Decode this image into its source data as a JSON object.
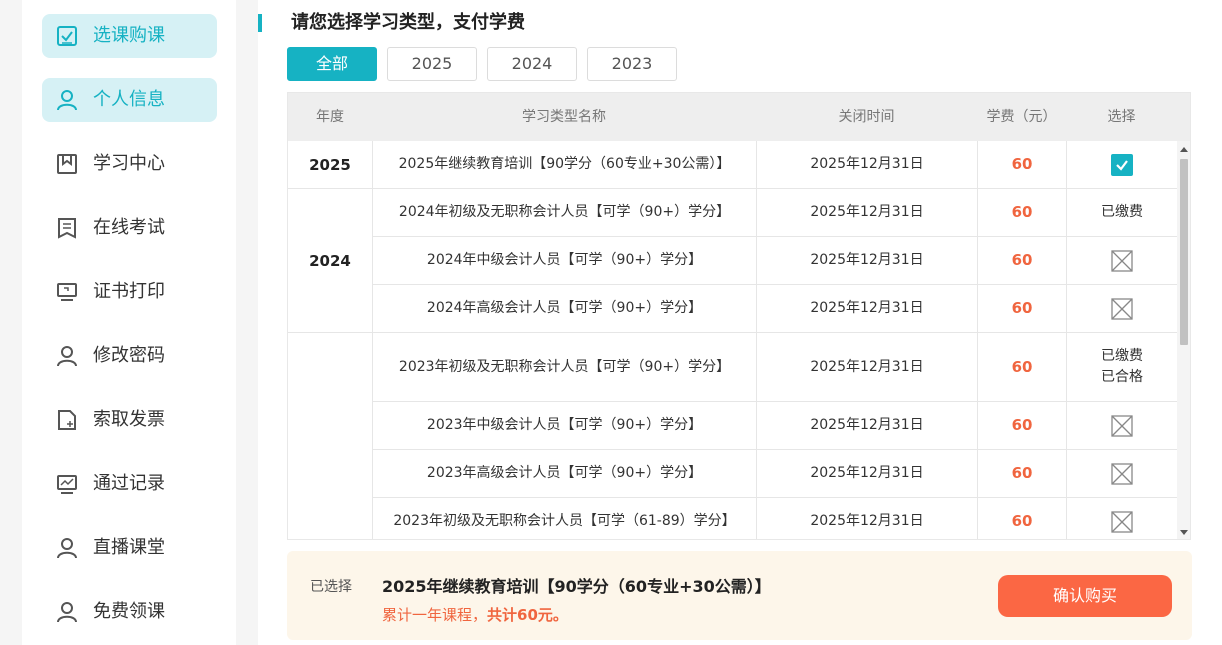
{
  "sidebar": {
    "items": [
      {
        "label": "选课购课",
        "icon": "checkbox-icon",
        "active": true
      },
      {
        "label": "个人信息",
        "icon": "user-icon",
        "active": true
      },
      {
        "label": "学习中心",
        "icon": "bookmark-icon",
        "active": false
      },
      {
        "label": "在线考试",
        "icon": "document-icon",
        "active": false
      },
      {
        "label": "证书打印",
        "icon": "monitor-icon",
        "active": false
      },
      {
        "label": "修改密码",
        "icon": "user-icon",
        "active": false
      },
      {
        "label": "索取发票",
        "icon": "file-add-icon",
        "active": false
      },
      {
        "label": "通过记录",
        "icon": "chart-icon",
        "active": false
      },
      {
        "label": "直播课堂",
        "icon": "user-icon",
        "active": false
      },
      {
        "label": "免费领课",
        "icon": "user-icon",
        "active": false
      }
    ]
  },
  "main": {
    "title": "请您选择学习类型，支付学费",
    "tabs": [
      {
        "label": "全部",
        "active": true
      },
      {
        "label": "2025",
        "active": false
      },
      {
        "label": "2024",
        "active": false
      },
      {
        "label": "2023",
        "active": false
      }
    ]
  },
  "table": {
    "headers": [
      "年度",
      "学习类型名称",
      "关闭时间",
      "学费（元）",
      "选择"
    ],
    "groups": [
      {
        "year": "2025",
        "rows": [
          {
            "name": "2025年继续教育培训【90学分（60专业+30公需）】",
            "close": "2025年12月31日",
            "fee": "60",
            "state": "checked",
            "status": ""
          }
        ]
      },
      {
        "year": "2024",
        "rows": [
          {
            "name": "2024年初级及无职称会计人员【可学（90+）学分】",
            "close": "2025年12月31日",
            "fee": "60",
            "state": "text",
            "status": "已缴费"
          },
          {
            "name": "2024年中级会计人员【可学（90+）学分】",
            "close": "2025年12月31日",
            "fee": "60",
            "state": "disabled",
            "status": ""
          },
          {
            "name": "2024年高级会计人员【可学（90+）学分】",
            "close": "2025年12月31日",
            "fee": "60",
            "state": "disabled",
            "status": ""
          }
        ]
      },
      {
        "year": "",
        "rows": [
          {
            "name": "2023年初级及无职称会计人员【可学（90+）学分】",
            "close": "2025年12月31日",
            "fee": "60",
            "state": "text",
            "status": "已缴费\n已合格"
          },
          {
            "name": "2023年中级会计人员【可学（90+）学分】",
            "close": "2025年12月31日",
            "fee": "60",
            "state": "disabled",
            "status": ""
          },
          {
            "name": "2023年高级会计人员【可学（90+）学分】",
            "close": "2025年12月31日",
            "fee": "60",
            "state": "disabled",
            "status": ""
          },
          {
            "name": "2023年初级及无职称会计人员【可学（61-89）学分】",
            "close": "2025年12月31日",
            "fee": "60",
            "state": "disabled",
            "status": ""
          }
        ]
      }
    ]
  },
  "footer": {
    "selected_label": "已选择",
    "selected_course": "2025年继续教育培训【90学分（60专业+30公需）】",
    "total_prefix": "累计一年课程，",
    "total_amount": "共计60元。",
    "confirm_button": "确认购买"
  },
  "colors": {
    "accent": "#16b2c3",
    "fee": "#f0653f",
    "button": "#fb6744",
    "footer_bg": "#fdf6ea"
  }
}
